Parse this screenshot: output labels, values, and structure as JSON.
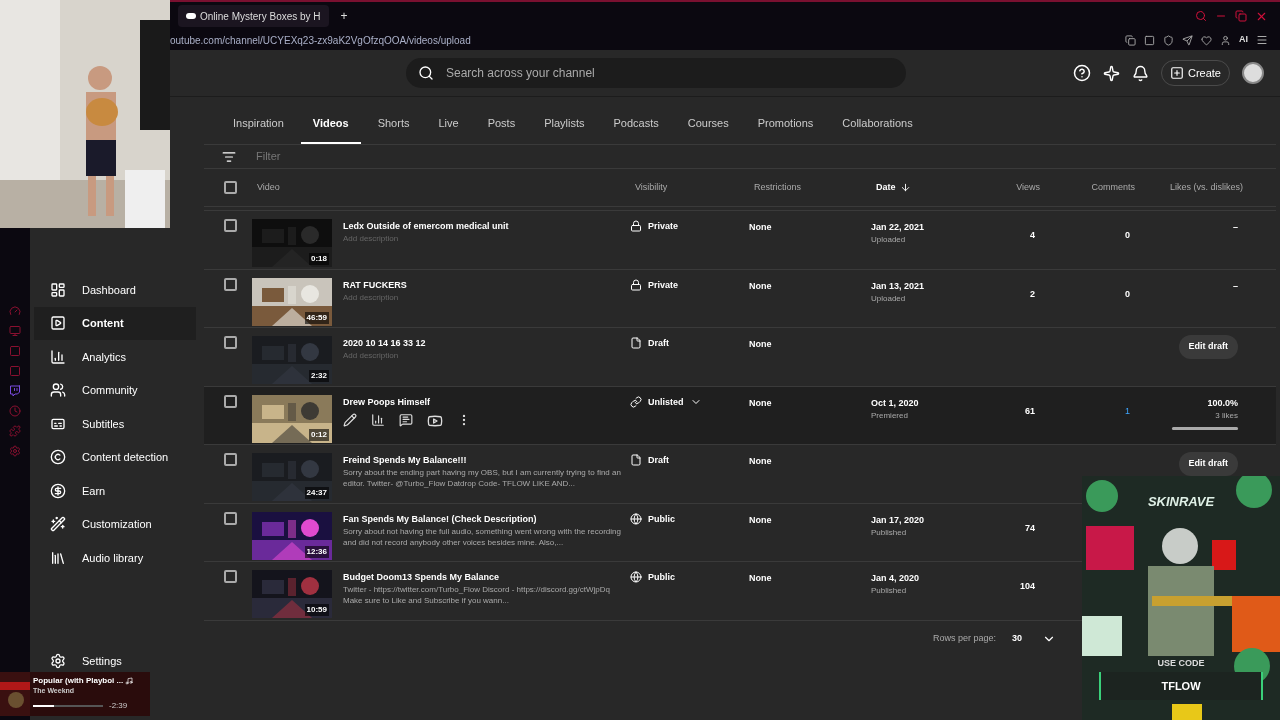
{
  "browser": {
    "tab_title": "Online Mystery Boxes by H",
    "new_tab": "+",
    "url": "outube.com/channel/UCYEXq23-zx9aK2VgOfzqOOA/videos/upload",
    "ai_label": "AI"
  },
  "header": {
    "search_placeholder": "Search across your channel",
    "create": "Create"
  },
  "sidebar": {
    "items": [
      {
        "label": "Dashboard",
        "kind": "dashboard",
        "selected": false
      },
      {
        "label": "Content",
        "kind": "content",
        "selected": true
      },
      {
        "label": "Analytics",
        "kind": "analytics",
        "selected": false
      },
      {
        "label": "Community",
        "kind": "community",
        "selected": false
      },
      {
        "label": "Subtitles",
        "kind": "subtitles",
        "selected": false
      },
      {
        "label": "Content detection",
        "kind": "copyright",
        "selected": false
      },
      {
        "label": "Earn",
        "kind": "earn",
        "selected": false
      },
      {
        "label": "Customization",
        "kind": "customization",
        "selected": false
      },
      {
        "label": "Audio library",
        "kind": "audio",
        "selected": false
      }
    ],
    "settings": "Settings"
  },
  "tabs": [
    {
      "label": "Inspiration",
      "selected": false
    },
    {
      "label": "Videos",
      "selected": true
    },
    {
      "label": "Shorts",
      "selected": false
    },
    {
      "label": "Live",
      "selected": false
    },
    {
      "label": "Posts",
      "selected": false
    },
    {
      "label": "Playlists",
      "selected": false
    },
    {
      "label": "Podcasts",
      "selected": false
    },
    {
      "label": "Courses",
      "selected": false
    },
    {
      "label": "Promotions",
      "selected": false
    },
    {
      "label": "Collaborations",
      "selected": false
    }
  ],
  "filter_placeholder": "Filter",
  "table": {
    "select_all": {
      "checked": false
    },
    "columns": [
      "Video",
      "Visibility",
      "Restrictions",
      "Date",
      "Views",
      "Comments",
      "Likes (vs. dislikes)"
    ],
    "rows": [
      {
        "kind": "private",
        "duration": "0:18",
        "title": "Ledx Outside of emercom medical unit",
        "placeholder": "Add description",
        "visibility": "Private",
        "restrictions": "None",
        "date": "Jan 22, 2021",
        "date_status": "Uploaded",
        "views": "4",
        "comments": "0",
        "likes": "–",
        "checked": false,
        "hovered": false
      },
      {
        "kind": "private",
        "duration": "46:59",
        "title": "RAT FUCKERS",
        "placeholder": "Add description",
        "visibility": "Private",
        "restrictions": "None",
        "date": "Jan 13, 2021",
        "date_status": "Uploaded",
        "views": "2",
        "comments": "0",
        "likes": "–",
        "checked": false,
        "hovered": false
      },
      {
        "kind": "draft",
        "duration": "2:32",
        "title": "2020 10 14 16 33 12",
        "placeholder": "Add description",
        "visibility": "Draft",
        "restrictions": "None",
        "action": "Edit draft",
        "checked": false,
        "hovered": false
      },
      {
        "kind": "unlisted",
        "duration": "0:12",
        "title": "Drew Poops Himself",
        "visibility": "Unlisted",
        "restrictions": "None",
        "date": "Oct 1, 2020",
        "date_status": "Premiered",
        "views": "61",
        "comments": "1",
        "likes": "100.0%",
        "likes_sub": "3 likes",
        "level": 1,
        "checked": false,
        "hovered": true
      },
      {
        "kind": "draft",
        "duration": "24:37",
        "title": "Freind Spends My Balance!!!",
        "description": "Sorry about the ending part having my OBS, but I am currently trying to find an editor. Twitter- @Turbo_Flow Datdrop Code- TFLOW LIKE AND...",
        "visibility": "Draft",
        "restrictions": "None",
        "action": "Edit draft",
        "checked": false,
        "hovered": false
      },
      {
        "kind": "public",
        "duration": "12:36",
        "title": "Fan Spends My Balance! (Check Description)",
        "description": "Sorry about not having the full audio, something went wrong with the recording and did not record anybody other voices besides mine. Also,...",
        "visibility": "Public",
        "restrictions": "None",
        "date": "Jan 17, 2020",
        "date_status": "Published",
        "views": "74",
        "checked": false,
        "hovered": false
      },
      {
        "kind": "public",
        "duration": "10:59",
        "title": "Budget Doom13 Spends My Balance",
        "description": "Twitter - https://twitter.com/Turbo_Flow Discord - https://discord.gg/ctWjpDq Make sure to Like and Subscribe if you wann...",
        "visibility": "Public",
        "restrictions": "None",
        "date": "Jan 4, 2020",
        "date_status": "Published",
        "views": "104",
        "checked": false,
        "hovered": false
      }
    ]
  },
  "pagination": {
    "label": "Rows per page:",
    "value": "30"
  },
  "music": {
    "title": "Popular (with Playboi ...",
    "artist": "The Weeknd",
    "time": "-2:39",
    "level": 0.3
  },
  "ad": {
    "brand": "SKINRAVE",
    "code_label": "USE CODE",
    "code": "TFLOW"
  }
}
